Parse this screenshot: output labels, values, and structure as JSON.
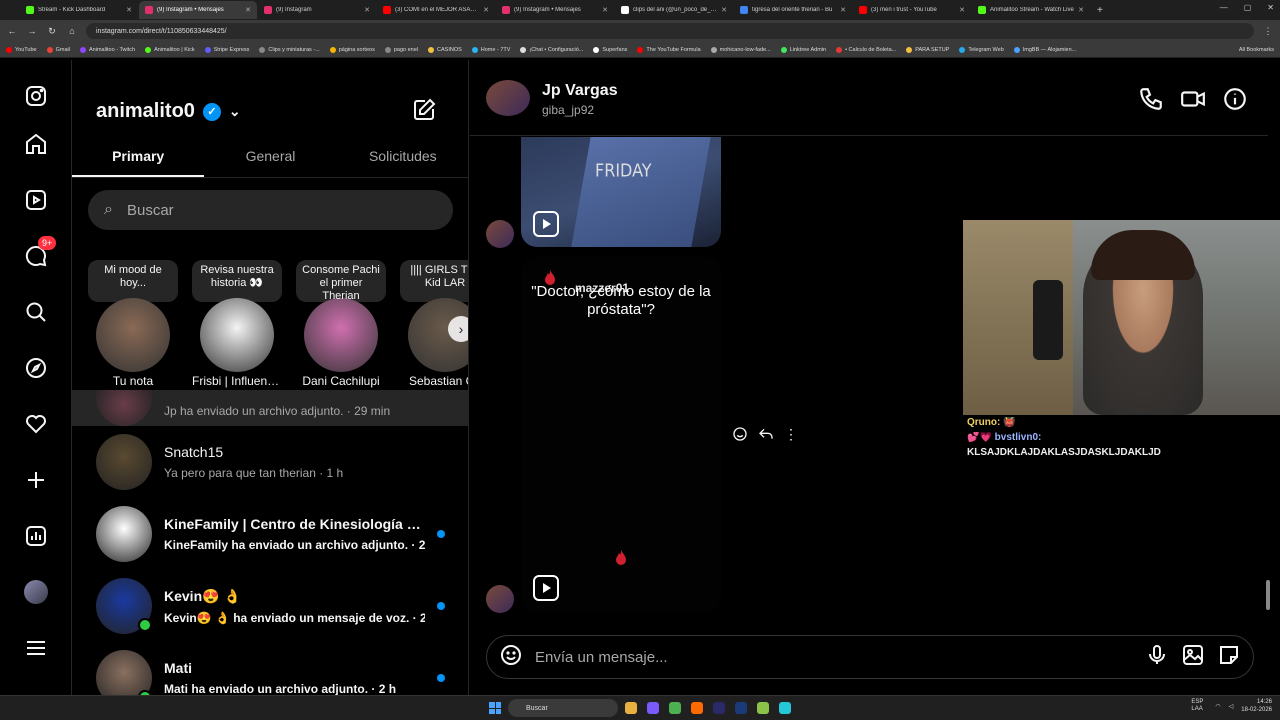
{
  "browser": {
    "tabs": [
      {
        "title": "Stream - Kick Dashboard",
        "color": "#53fc18",
        "active": false
      },
      {
        "title": "(9) Instagram • Mensajes",
        "color": "#e1306c",
        "active": true
      },
      {
        "title": "(9) Instagram",
        "color": "#e1306c",
        "active": false
      },
      {
        "title": "(3) COMÍ en el MEJOR ASADOR",
        "color": "#ff0000",
        "active": false
      },
      {
        "title": "(9) Instagram • Mensajes",
        "color": "#e1306c",
        "active": false
      },
      {
        "title": "clips del ani (@un_poco_de_an",
        "color": "#ffffff",
        "active": false
      },
      {
        "title": "tigresa del oriente therian - Bu",
        "color": "#4285f4",
        "active": false
      },
      {
        "title": "(3) men i trust - YouTube",
        "color": "#ff0000",
        "active": false
      },
      {
        "title": "Animalitoo Stream - Watch Live",
        "color": "#53fc18",
        "active": false
      }
    ],
    "url": "instagram.com/direct/t/110850633448425/",
    "bookmarks": [
      "YouTube",
      "Gmail",
      "Animalitoo - Twitch",
      "Animalitoo | Kick",
      "Stripe Express",
      "Clips y miniaturas -...",
      "página sorteos",
      "pago enel",
      "CASINOS",
      "Home - 7TV",
      "¡Chat • Configuració...",
      "Superfans",
      "The YouTube Formula",
      "mohicano-low-fade...",
      "Linktree Admin",
      "• Calculo de Boleta...",
      "PARA SETUP",
      "Telegram Web",
      "ImgBB — Alojamien..."
    ],
    "all_bookmarks": "All Bookmarks"
  },
  "nav": {
    "badge": "9+",
    "icons": [
      "instagram-logo-icon",
      "home-icon",
      "reels-icon",
      "messages-icon",
      "search-icon",
      "explore-icon",
      "notifications-icon",
      "create-icon",
      "dashboard-icon",
      "profile-icon",
      "more-icon"
    ]
  },
  "inbox": {
    "account": "animalito0",
    "tabs": [
      "Primary",
      "General",
      "Solicitudes"
    ],
    "search_placeholder": "Buscar",
    "notes": [
      {
        "note": "Mi mood de hoy...",
        "name": "Tu nota",
        "color": "#8a6a55"
      },
      {
        "note": "Revisa nuestra historia 👀",
        "name": "Frisbi | Influence...",
        "color": "#f4f4f4"
      },
      {
        "note": "Consome Pachi el primer Therian",
        "name": "Dani Cachilupi",
        "color": "#d070b0"
      },
      {
        "note": "|||| GIRLS The Kid LAR",
        "name": "Sebastian Cu",
        "color": "#6a5a4a"
      }
    ],
    "conversations": [
      {
        "name": "Jp Vargas",
        "preview": "Jp ha enviado un archivo adjunto. · 29 min",
        "unread": false,
        "online": false,
        "color": "#6a3d4a"
      },
      {
        "name": "Snatch15",
        "preview": "Ya pero para que tan therian · 1 h",
        "unread": false,
        "online": false,
        "color": "#5a4a30"
      },
      {
        "name": "KineFamily | Centro de Kinesiología en ...",
        "preview": "KineFamily ha enviado un archivo adjunto. · 2 h",
        "unread": true,
        "online": false,
        "color": "#ffffff"
      },
      {
        "name": "Kevin😍 👌",
        "preview": "Kevin😍 👌 ha enviado un mensaje de voz. · 2 h",
        "unread": true,
        "online": true,
        "color": "#1a3aa0"
      },
      {
        "name": "Mati",
        "preview": "Mati ha enviado un archivo adjunto. · 2 h",
        "unread": true,
        "online": true,
        "color": "#8a7060"
      }
    ]
  },
  "thread": {
    "name": "Jp Vargas",
    "username": "giba_jp92",
    "reel1_text": "FRIDAY",
    "reel2_user": "mazzer01",
    "reel2_caption": "\"Doctor, ¿cómo estoy de la próstata\"?",
    "composer_placeholder": "Envía un mensaje..."
  },
  "stream_chat": [
    {
      "user": "Qruno:",
      "text": "👹"
    },
    {
      "user": "💕💗 bvstlivn0:",
      "text": ""
    },
    {
      "user": "",
      "text": "KLSAJDKLAJDAKLASJDASKLJDAKLJD"
    }
  ],
  "taskbar": {
    "search": "Buscar",
    "lang": "ESP LAA",
    "time": "14:26",
    "date": "18-02-2026"
  }
}
